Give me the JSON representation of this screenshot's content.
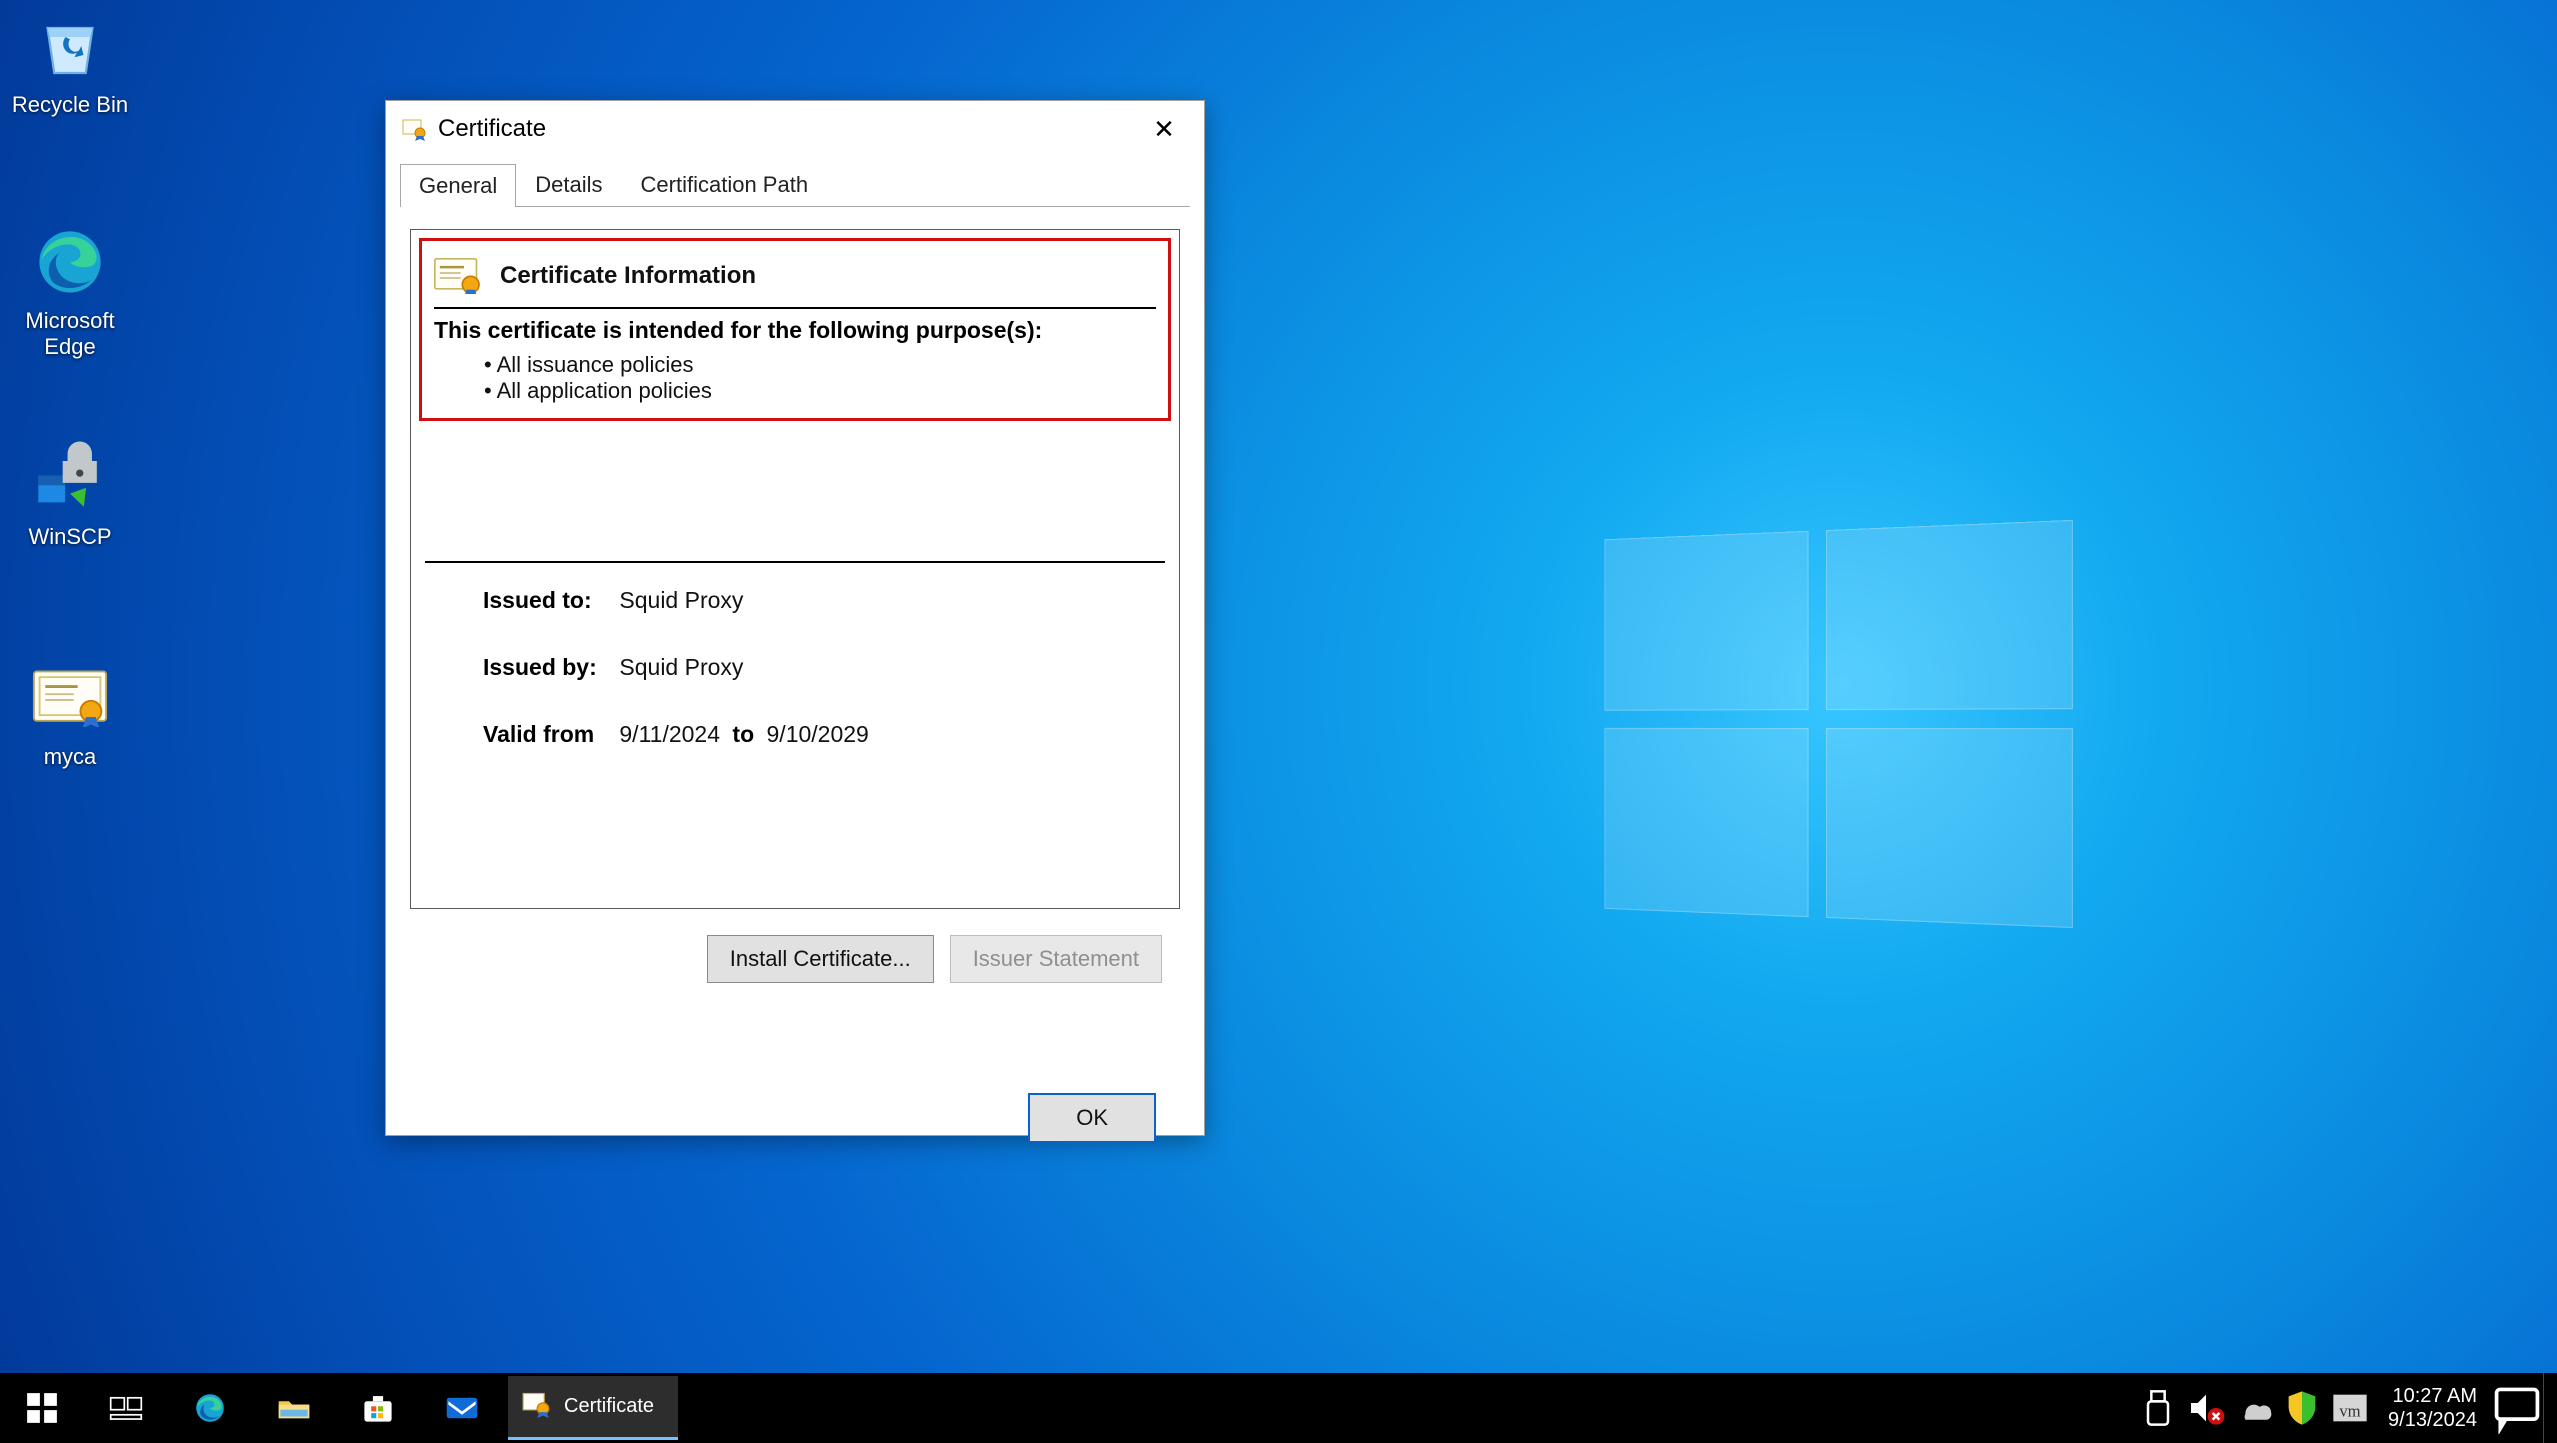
{
  "desktop": {
    "icons": [
      {
        "label": "Recycle Bin"
      },
      {
        "label": "Microsoft Edge"
      },
      {
        "label": "WinSCP"
      },
      {
        "label": "myca"
      }
    ]
  },
  "dialog": {
    "title": "Certificate",
    "tabs": {
      "general": "General",
      "details": "Details",
      "path": "Certification Path"
    },
    "cert_info_header": "Certificate Information",
    "purpose_intro": "This certificate is intended for the following purpose(s):",
    "purposes": [
      "All issuance policies",
      "All application policies"
    ],
    "issued_to_label": "Issued to:",
    "issued_to_value": "Squid Proxy",
    "issued_by_label": "Issued by:",
    "issued_by_value": "Squid Proxy",
    "valid_from_label": "Valid from",
    "valid_from_value": "9/11/2024",
    "valid_to_label": "to",
    "valid_to_value": "9/10/2029",
    "install_button": "Install Certificate...",
    "issuer_button": "Issuer Statement",
    "ok_button": "OK"
  },
  "taskbar": {
    "active_app": "Certificate",
    "time": "10:27 AM",
    "date": "9/13/2024"
  }
}
